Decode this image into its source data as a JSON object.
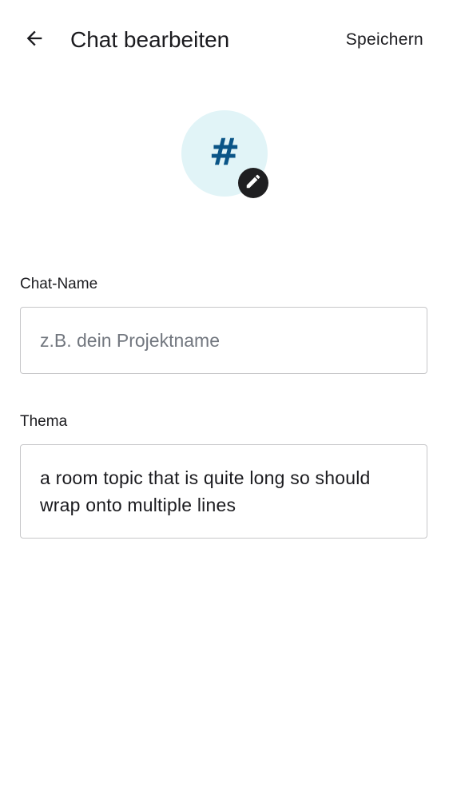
{
  "header": {
    "back_icon": "arrow-back-icon",
    "title": "Chat bearbeiten",
    "save_label": "Speichern"
  },
  "avatar": {
    "glyph": "#",
    "background_color": "#e1f4f7",
    "glyph_color": "#0a5587",
    "edit_icon": "pencil-icon"
  },
  "fields": {
    "name": {
      "label": "Chat-Name",
      "value": "",
      "placeholder": "z.B. dein Projektname"
    },
    "topic": {
      "label": "Thema",
      "value": "a room topic that is quite long so should wrap onto multiple lines"
    }
  }
}
